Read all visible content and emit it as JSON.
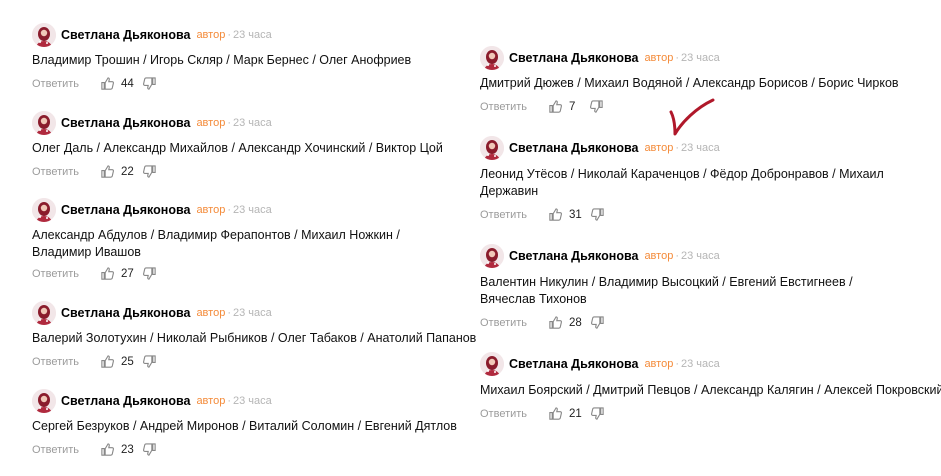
{
  "comments_left": [
    {
      "author": "Светлана Дьяконова",
      "badge": "автор",
      "sep": "·",
      "time": "23 часа",
      "text": "Владимир Трошин / Игорь Скляр / Марк Бернес / Олег Анофриев",
      "reply": "Ответить",
      "likes": "44"
    },
    {
      "author": "Светлана Дьяконова",
      "badge": "автор",
      "sep": "·",
      "time": "23 часа",
      "text": "Олег Даль / Александр Михайлов / Александр Хочинский / Виктор Цой",
      "reply": "Ответить",
      "likes": "22"
    },
    {
      "author": "Светлана Дьяконова",
      "badge": "автор",
      "sep": "·",
      "time": "23 часа",
      "text": "Александр Абдулов / Владимир Ферапонтов / Михаил Ножкин / Владимир Ивашов",
      "reply": "Ответить",
      "likes": "27"
    },
    {
      "author": "Светлана Дьяконова",
      "badge": "автор",
      "sep": "·",
      "time": "23 часа",
      "text": "Валерий Золотухин / Николай Рыбников / Олег Табаков / Анатолий Папанов",
      "reply": "Ответить",
      "likes": "25"
    },
    {
      "author": "Светлана Дьяконова",
      "badge": "автор",
      "sep": "·",
      "time": "23 часа",
      "text": "Сергей Безруков / Андрей Миронов / Виталий Соломин / Евгений Дятлов",
      "reply": "Ответить",
      "likes": "23"
    }
  ],
  "comments_right": [
    {
      "author": "Светлана Дьяконова",
      "badge": "автор",
      "sep": "·",
      "time": "23 часа",
      "text": "Дмитрий Дюжев / Михаил Водяной / Александр Борисов / Борис Чирков",
      "reply": "Ответить",
      "likes": "7"
    },
    {
      "author": "Светлана Дьяконова",
      "badge": "автор",
      "sep": "·",
      "time": "23 часа",
      "text": "Леонид Утёсов / Николай Караченцов / Фёдор Добронравов / Михаил Державин",
      "reply": "Ответить",
      "likes": "31"
    },
    {
      "author": "Светлана Дьяконова",
      "badge": "автор",
      "sep": "·",
      "time": "23 часа",
      "text": "Валентин Никулин / Владимир Высоцкий / Евгений Евстигнеев / Вячеслав Тихонов",
      "reply": "Ответить",
      "likes": "28"
    },
    {
      "author": "Светлана Дьяконова",
      "badge": "автор",
      "sep": "·",
      "time": "23 часа",
      "text": "Михаил Боярский / Дмитрий Певцов / Александр Калягин / Алексей Покровский",
      "reply": "Ответить",
      "likes": "21"
    }
  ],
  "colors": {
    "badge": "#f48b3a",
    "muted": "#b5b5b5",
    "mark": "#b0182a"
  },
  "icons": {
    "like": "thumb-up-icon",
    "dislike": "thumb-down-icon",
    "avatar": "avatar"
  }
}
